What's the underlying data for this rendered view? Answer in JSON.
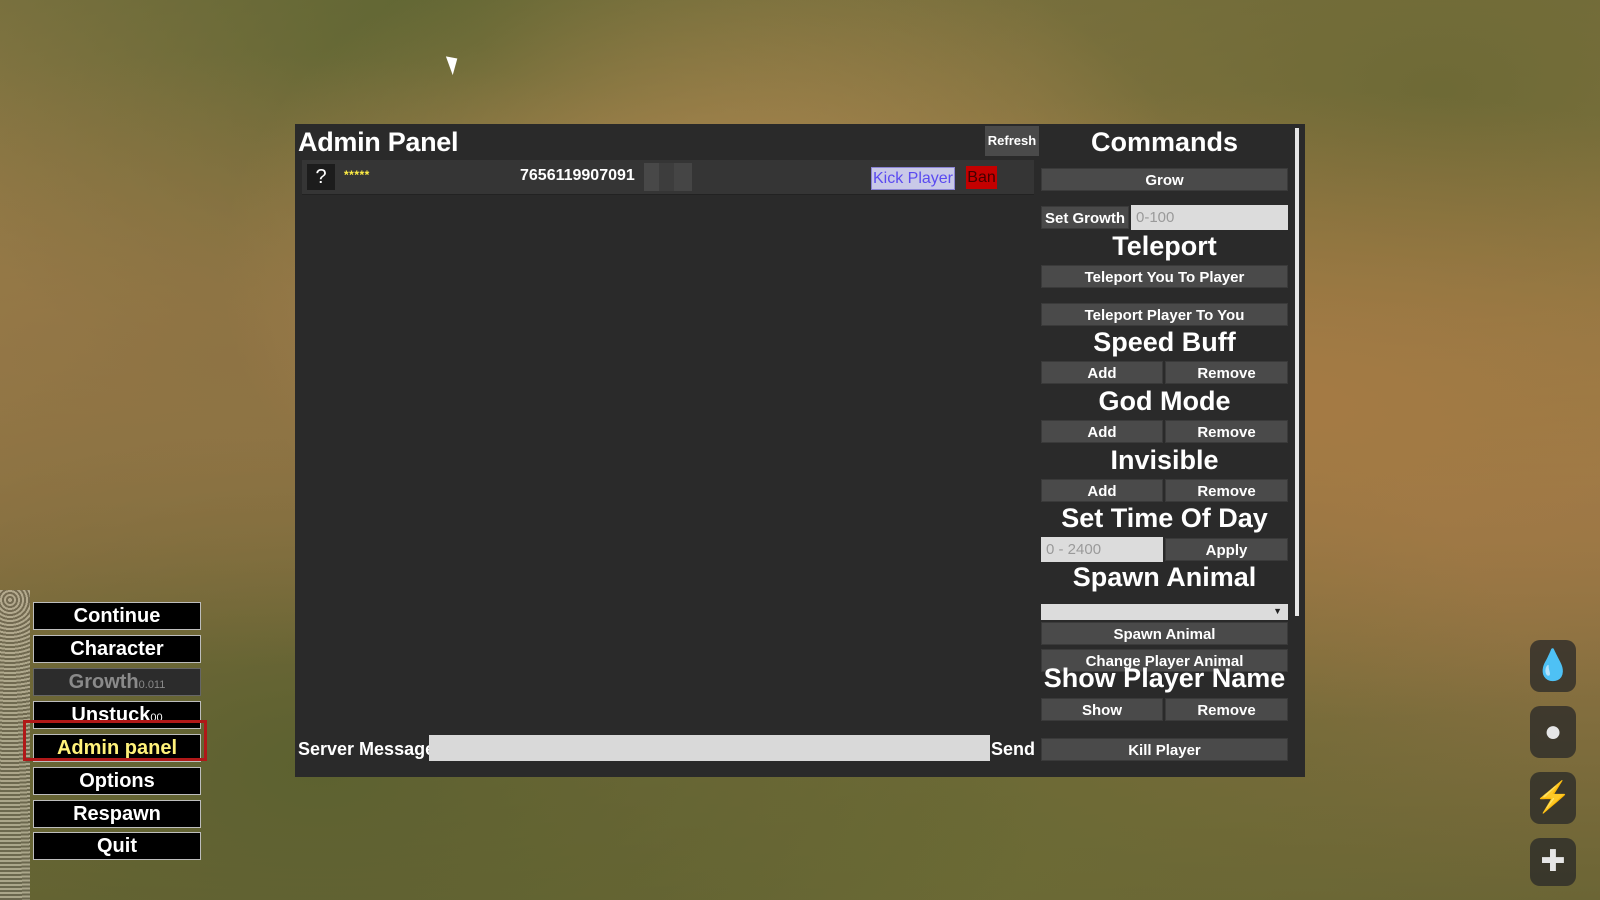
{
  "admin_panel": {
    "title": "Admin Panel",
    "refresh_label": "Refresh",
    "players": [
      {
        "icon": "?",
        "name": "*****",
        "steam_id": "7656119907091",
        "kick_label": "Kick Player",
        "ban_label": "Ban"
      }
    ],
    "server_message_label": "Server Message",
    "server_message_value": "",
    "send_label": "Send"
  },
  "commands": {
    "title": "Commands",
    "grow_label": "Grow",
    "set_growth_label": "Set Growth",
    "set_growth_placeholder": "0-100",
    "teleport_title": "Teleport",
    "teleport_you_label": "Teleport You To Player",
    "teleport_player_label": "Teleport Player To You",
    "speed_buff_title": "Speed Buff",
    "god_mode_title": "God Mode",
    "invisible_title": "Invisible",
    "add_label": "Add",
    "remove_label": "Remove",
    "time_title": "Set Time Of Day",
    "time_placeholder": "0 - 2400",
    "apply_label": "Apply",
    "spawn_title": "Spawn Animal",
    "spawn_selected": "",
    "spawn_label": "Spawn Animal",
    "change_animal_label": "Change Player Animal",
    "show_name_title": "Show Player Name",
    "show_label": "Show",
    "kill_label": "Kill  Player"
  },
  "pause_menu": {
    "continue": "Continue",
    "character": "Character",
    "growth": "Growth",
    "growth_value": "0.011",
    "unstuck": "Unstuck",
    "unstuck_value": "00",
    "admin_panel": "Admin panel",
    "options": "Options",
    "respawn": "Respawn",
    "quit": "Quit"
  },
  "status_icons": [
    "water-drop-icon",
    "stomach-icon",
    "stamina-bolt-icon",
    "health-plus-icon"
  ],
  "colors": {
    "panel_bg": "#2a2a2a",
    "button_bg": "#4a4a4a",
    "kick_bg": "#c9c9e8",
    "kick_text": "#5a4af0",
    "ban_bg": "#c40000",
    "active_menu_text": "#fff27a",
    "highlight_border": "#b01818",
    "stars": "#ffee44"
  }
}
